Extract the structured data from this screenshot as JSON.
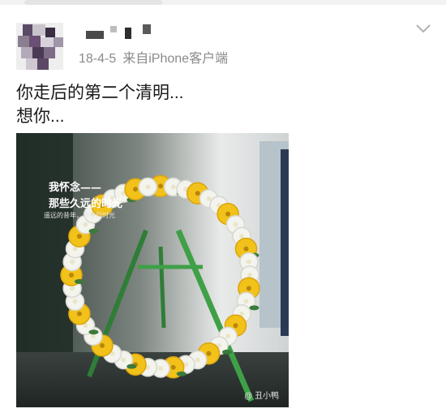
{
  "post": {
    "date": "18-4-5",
    "source": "来自iPhone客户端",
    "lines": [
      "你走后的第二个清明...",
      "想你..."
    ]
  },
  "photo": {
    "caption_line1": "我怀念——",
    "caption_line2": "那些久远的时光",
    "caption_small": "遥远的昔年，和往日时光",
    "watermark": "@ 丑小鸭"
  },
  "icons": {
    "menu": "chevron-down-icon",
    "weibo_logo": "weibo-logo-icon"
  },
  "colors": {
    "meta_text": "#8a8a8a",
    "flower_yellow": "#f2c21a",
    "flower_white": "#f4f4ef",
    "stand_green": "#3fa047"
  }
}
